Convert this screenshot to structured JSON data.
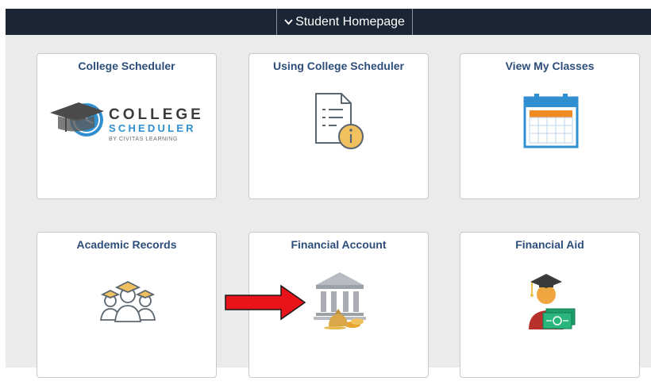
{
  "header": {
    "title": "Student Homepage",
    "dropdown_icon": "chevron-down-icon"
  },
  "tiles": [
    {
      "title": "College Scheduler",
      "icon": "college-scheduler-logo",
      "logo_text": {
        "line1": "COLLEGE",
        "line2": "SCHEDULER",
        "line3": "BY CIVITAS LEARNING"
      }
    },
    {
      "title": "Using College Scheduler",
      "icon": "document-info-icon"
    },
    {
      "title": "View My Classes",
      "icon": "calendar-icon"
    },
    {
      "title": "Academic Records",
      "icon": "graduates-icon"
    },
    {
      "title": "Financial Account",
      "icon": "bank-money-icon"
    },
    {
      "title": "Financial Aid",
      "icon": "graduate-money-icon"
    }
  ],
  "annotation": {
    "icon": "red-arrow-icon",
    "color": "#e8141a"
  },
  "colors": {
    "header_bg": "#1b2634",
    "tile_title": "#2d4e7a",
    "accent_blue": "#2f8fd0",
    "accent_gold": "#f2c15f"
  }
}
